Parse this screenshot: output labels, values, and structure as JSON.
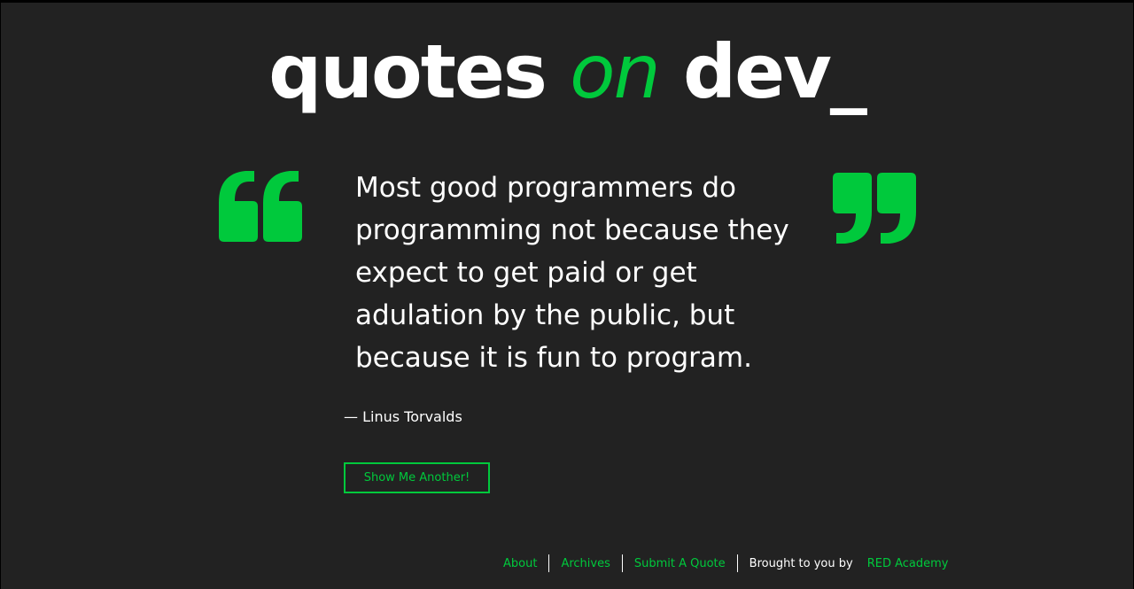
{
  "logo": {
    "word1": "quotes",
    "word2": "on",
    "word3": "dev_"
  },
  "quote": {
    "text": "Most good programmers do programming not because they expect to get paid or get adulation by the public, but because it is fun to program.",
    "author": "— Linus Torvalds"
  },
  "actions": {
    "another_label": "Show Me Another!"
  },
  "footer": {
    "links": [
      "About",
      "Archives",
      "Submit A Quote"
    ],
    "credit_text": "Brought to you by",
    "credit_link": "RED Academy"
  },
  "colors": {
    "background": "#222222",
    "accent": "#00c93c",
    "text": "#ffffff"
  },
  "icons": {
    "open_quote": "open-quote-icon",
    "close_quote": "close-quote-icon"
  }
}
